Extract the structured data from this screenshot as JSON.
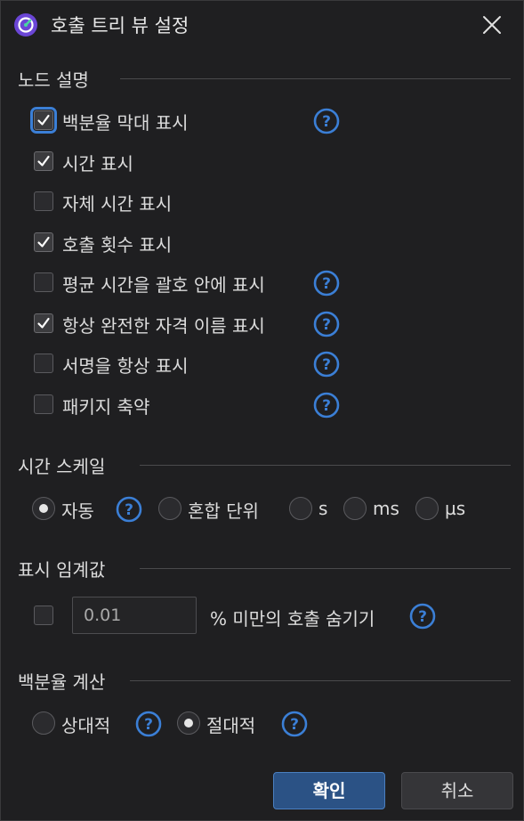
{
  "window": {
    "title": "호출 트리 뷰 설정",
    "accent": "#3b7fd6"
  },
  "node_desc": {
    "heading": "노드 설명",
    "items": [
      {
        "label": "백분율 막대 표시",
        "checked": true,
        "help": true
      },
      {
        "label": "시간 표시",
        "checked": true,
        "help": false
      },
      {
        "label": "자체 시간 표시",
        "checked": false,
        "help": false
      },
      {
        "label": "호출 횟수 표시",
        "checked": true,
        "help": false
      },
      {
        "label": "평균 시간을 괄호 안에 표시",
        "checked": false,
        "help": true
      },
      {
        "label": "항상 완전한 자격 이름 표시",
        "checked": true,
        "help": true
      },
      {
        "label": "서명을 항상 표시",
        "checked": false,
        "help": true
      },
      {
        "label": "패키지 축약",
        "checked": false,
        "help": true
      }
    ]
  },
  "time_scale": {
    "heading": "시간 스케일",
    "options": [
      {
        "label": "자동",
        "selected": true
      },
      {
        "label": "혼합 단위",
        "selected": false
      },
      {
        "label": "s",
        "selected": false
      },
      {
        "label": "ms",
        "selected": false
      },
      {
        "label": "µs",
        "selected": false
      }
    ]
  },
  "threshold": {
    "heading": "표시 임계값",
    "checked": false,
    "value": "0.01",
    "suffix": "% 미만의 호출 숨기기"
  },
  "percent_calc": {
    "heading": "백분율 계산",
    "options": [
      {
        "label": "상대적",
        "selected": false
      },
      {
        "label": "절대적",
        "selected": true
      }
    ]
  },
  "buttons": {
    "ok": "확인",
    "cancel": "취소"
  }
}
